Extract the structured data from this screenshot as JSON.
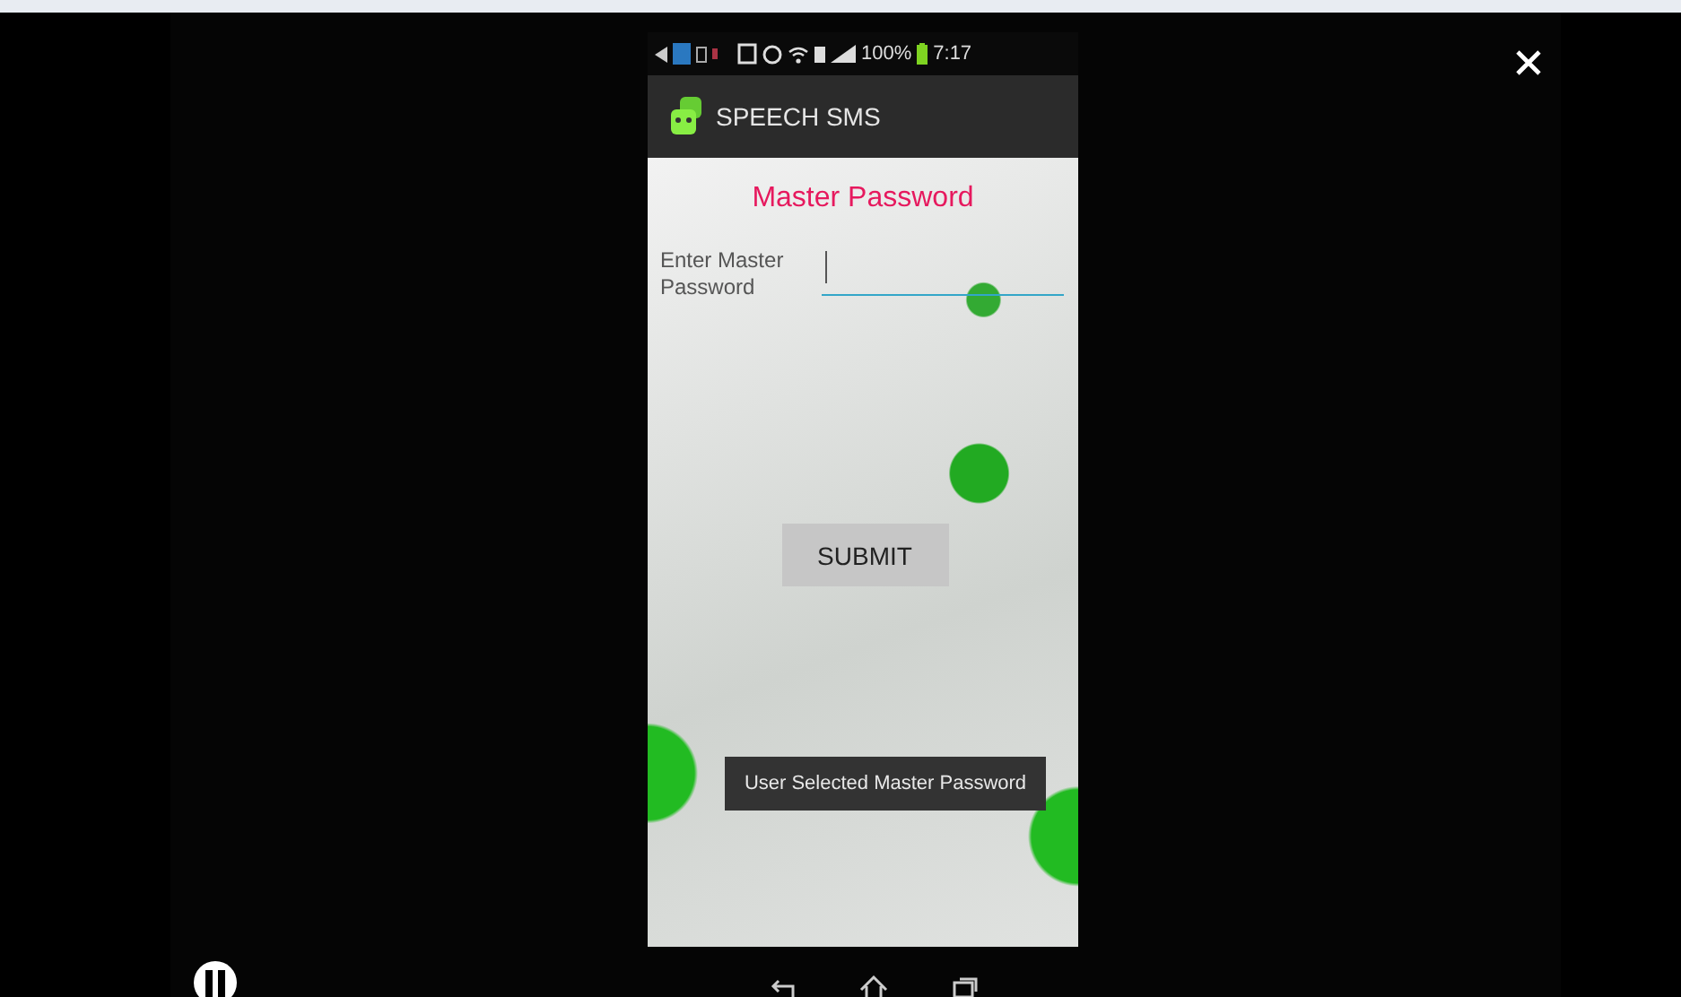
{
  "status_bar": {
    "battery": "100%",
    "time": "7:17"
  },
  "action_bar": {
    "title": "SPEECH SMS"
  },
  "screen": {
    "heading": "Master Password",
    "field_label": "Enter Master Password",
    "password_field": {
      "focused": true
    },
    "submit_button": "SUBMIT",
    "toast": "User Selected Master Password"
  }
}
